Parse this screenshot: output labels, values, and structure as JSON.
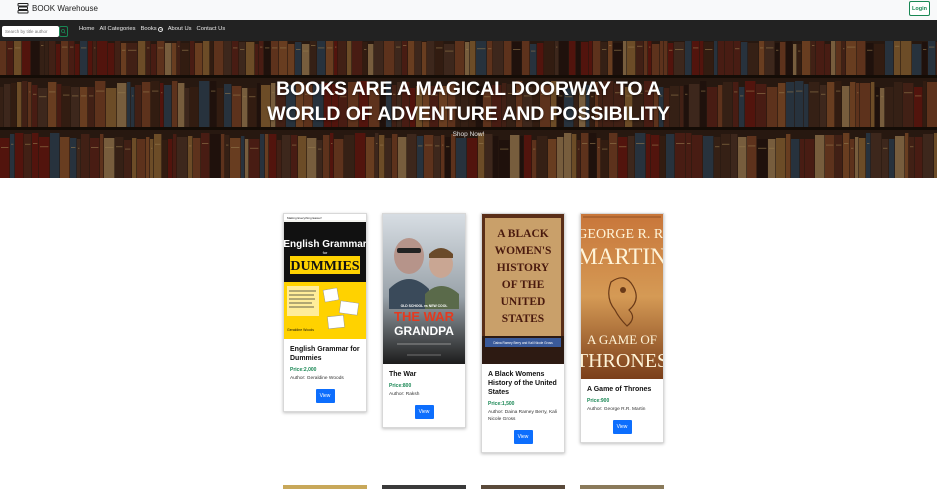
{
  "brand": {
    "name": "BOOK Warehouse",
    "icon": "books-stack-icon"
  },
  "header": {
    "login_label": "Login"
  },
  "nav": {
    "search_placeholder": "Search by title author",
    "search_icon": "search-icon",
    "links": [
      "Home",
      "All Categories",
      "Books",
      "About Us",
      "Contact Us"
    ]
  },
  "hero": {
    "title_line1": "BOOKS ARE A MAGICAL DOORWAY TO A",
    "title_line2": "WORLD OF ADVENTURE AND POSSIBILITY",
    "cta": "Shop Now!"
  },
  "books": [
    {
      "title": "English Grammar for Dummies",
      "price": "Price:2,000",
      "author": "Author: Geraldine Woods",
      "view": "View",
      "cover": {
        "top": "Making Everything Easier!",
        "main": "English Grammar",
        "sub": "DUMMIES",
        "bottom": "Geraldine Woods"
      }
    },
    {
      "title": "The War",
      "price": "Price:800",
      "author": "Author: Raksh",
      "view": "View",
      "cover": {
        "top": "OLD SCHOOL vs NEW COOL",
        "main": "THE WAR",
        "sub": "GRANDPA"
      }
    },
    {
      "title": "A Black Womens History of the United States",
      "price": "Price:1,500",
      "author": "Author: Daina Ramey Berry, Kali Nicole Gross",
      "view": "View",
      "cover": {
        "lines": [
          "A BLACK",
          "WOMEN'S",
          "HISTORY",
          "OF THE",
          "UNITED",
          "STATES"
        ],
        "bottom": "Daina Ramey Berry and Kali Nicole Gross"
      }
    },
    {
      "title": "A Game of Thrones",
      "price": "Price:900",
      "author": "Author: George R.R. Martin",
      "view": "View",
      "cover": {
        "top": "GEORGE R. R.",
        "main": "MARTIN",
        "lines": [
          "A GAME OF",
          "THRONES"
        ]
      }
    }
  ]
}
